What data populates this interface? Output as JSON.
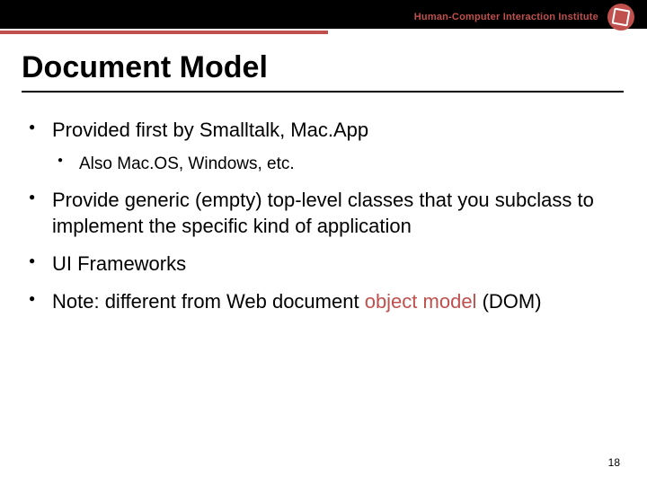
{
  "header": {
    "institute": "Human-Computer Interaction Institute"
  },
  "title": "Document Model",
  "bullets": [
    {
      "text": "Provided first by Smalltalk, Mac.App",
      "sub": [
        "Also Mac.OS, Windows, etc."
      ]
    },
    {
      "text": "Provide generic (empty) top-level classes that you subclass to implement the specific kind of application"
    },
    {
      "text": "UI Frameworks"
    },
    {
      "prefix": "Note: different from Web document ",
      "highlight": "object model",
      "suffix": " (DOM)"
    }
  ],
  "page_number": "18"
}
